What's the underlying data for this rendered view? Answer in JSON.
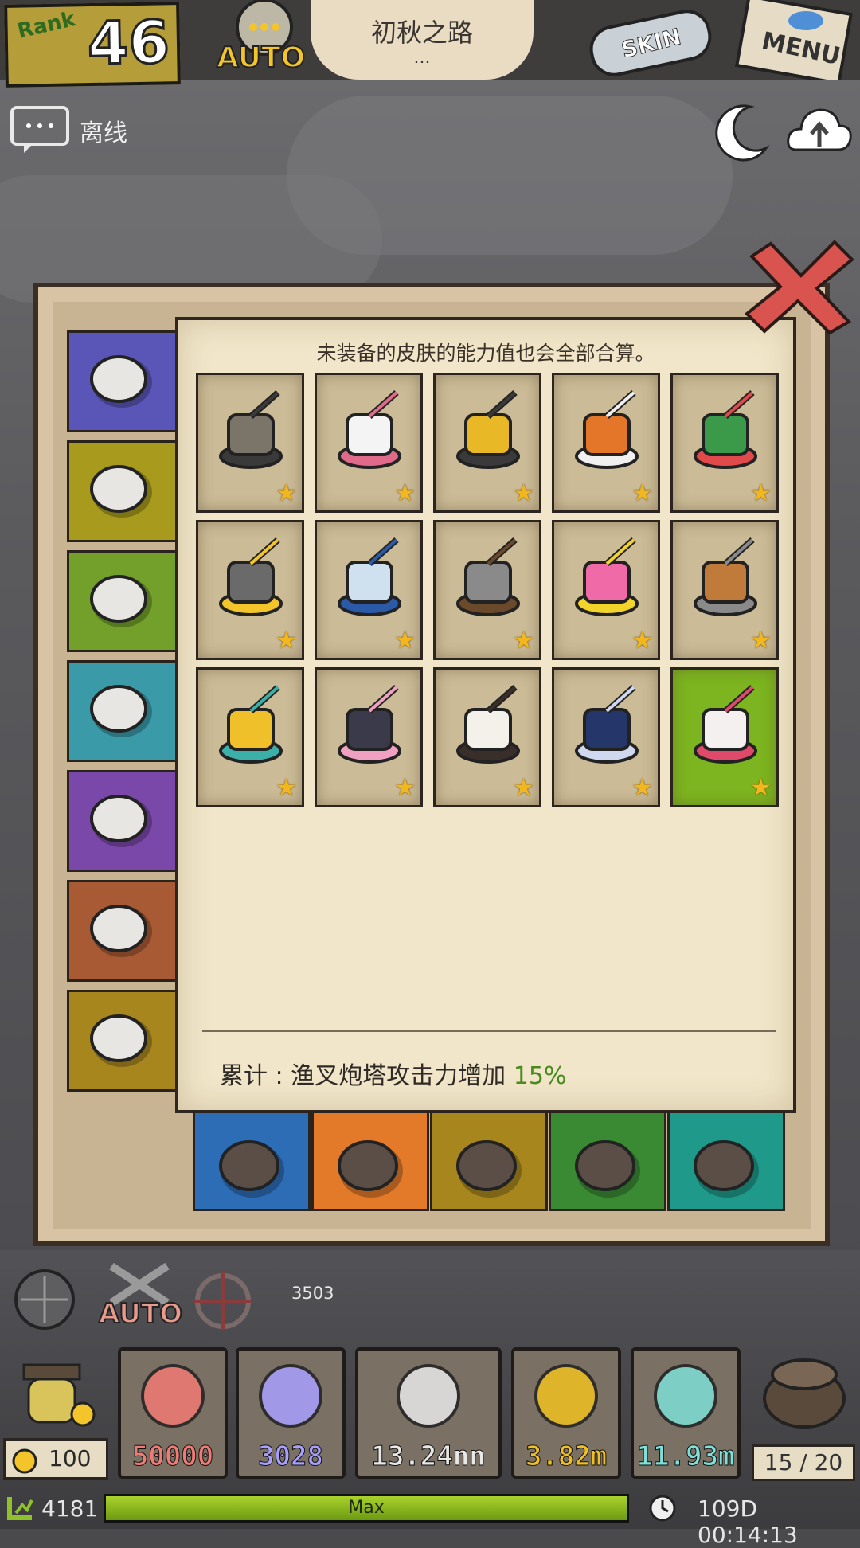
{
  "topbar": {
    "rank_label": "Rank",
    "rank_value": "46",
    "auto_label": "AUTO",
    "stage_title": "初秋之路",
    "stage_sub": "...",
    "skin_label": "SKIN",
    "menu_label": "MENU"
  },
  "chat": {
    "status": "离线"
  },
  "panel": {
    "note": "未装备的皮肤的能力值也会全部合算。",
    "total_label": "累计 : 渔叉炮塔攻击力增加",
    "total_value": "15%",
    "side_tabs": [
      {
        "icon": "harpoon-tower-icon",
        "color": "#5a56b8"
      },
      {
        "icon": "hat-icon",
        "color": "#a79a1c"
      },
      {
        "icon": "hair-icon",
        "color": "#72a02a"
      },
      {
        "icon": "outfit-icon",
        "color": "#3a9aa8"
      },
      {
        "icon": "ship-icon",
        "color": "#7a48a8"
      },
      {
        "icon": "bag-icon",
        "color": "#a85a34"
      },
      {
        "icon": "lantern-icon",
        "color": "#a8861e"
      }
    ],
    "skins": [
      {
        "icon": "cannon-turret-skin-icon",
        "stars": "★"
      },
      {
        "icon": "rabbit-launcher-skin-icon",
        "stars": "★"
      },
      {
        "icon": "golden-cannon-skin-icon",
        "stars": "★"
      },
      {
        "icon": "pumpkin-turret-skin-icon",
        "stars": "★"
      },
      {
        "icon": "wreath-turret-skin-icon",
        "stars": "★"
      },
      {
        "icon": "crossbow-turret-skin-icon",
        "stars": "★"
      },
      {
        "icon": "trident-jar-skin-icon",
        "stars": "★"
      },
      {
        "icon": "revolver-harpoon-skin-icon",
        "stars": "★"
      },
      {
        "icon": "firework-skin-icon",
        "stars": "★"
      },
      {
        "icon": "bread-basket-skin-icon",
        "stars": "★"
      },
      {
        "icon": "rainbow-tower-skin-icon",
        "stars": "★"
      },
      {
        "icon": "blossom-arch-skin-icon",
        "stars": "★"
      },
      {
        "icon": "cake-cannon-skin-icon",
        "stars": "★"
      },
      {
        "icon": "star-shield-skin-icon",
        "stars": "★"
      },
      {
        "icon": "bow-harpoon-skin-icon",
        "stars": "★",
        "selected": true
      }
    ],
    "bottom_tabs": [
      {
        "icon": "cat-icon",
        "color": "#2d6db5"
      },
      {
        "icon": "harpoon-icon",
        "color": "#e27a2a"
      },
      {
        "icon": "bomb-icon",
        "color": "#a8861e"
      },
      {
        "icon": "binoculars-icon",
        "color": "#3a8a34"
      },
      {
        "icon": "crystal-icon",
        "color": "#1f9a8a"
      }
    ]
  },
  "hud": {
    "auto_label": "AUTO",
    "distance": "3503",
    "boost_count": "100",
    "resources": [
      {
        "icon": "pearl-icon",
        "value": "50000",
        "color": "#f07a74"
      },
      {
        "icon": "skull-shield-icon",
        "value": "3028",
        "color": "#a8a0ff"
      },
      {
        "icon": "shell-icon",
        "value": "13.24nn",
        "color": "#e8e8e8"
      },
      {
        "icon": "amber-icon",
        "value": "3.82m",
        "color": "#f0c020"
      },
      {
        "icon": "diamond-icon",
        "value": "11.93m",
        "color": "#7ee0d8"
      }
    ],
    "slots_count": "15 / 20",
    "level": "4181",
    "xp_label": "Max",
    "xp_fraction": 1.0,
    "time": "109D 00:14:13"
  }
}
